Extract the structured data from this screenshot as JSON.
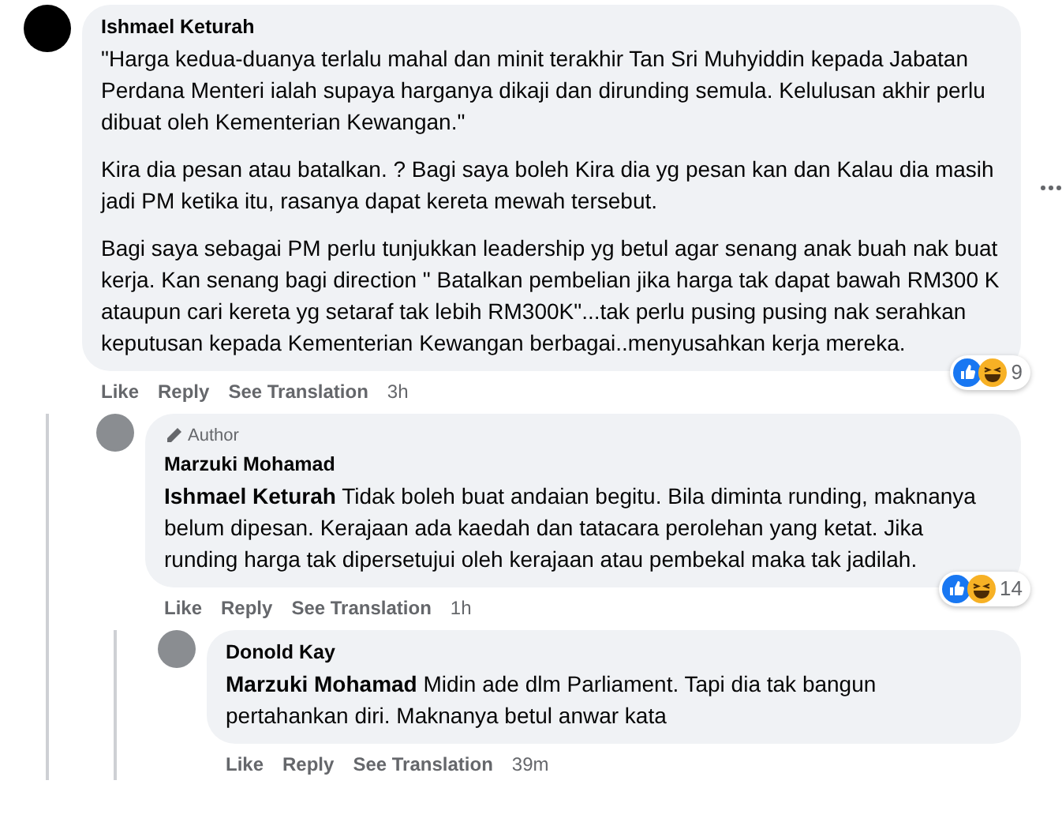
{
  "comments": [
    {
      "author": "Ishmael Keturah",
      "paragraphs": [
        "\"Harga kedua-duanya terlalu mahal dan minit terakhir Tan Sri Muhyiddin kepada Jabatan Perdana Menteri ialah supaya harganya dikaji dan dirunding semula. Kelulusan akhir perlu dibuat oleh Kementerian Kewangan.\"",
        "Kira dia pesan atau batalkan. ? Bagi saya boleh Kira dia yg pesan kan dan Kalau dia masih jadi PM ketika itu, rasanya dapat kereta mewah tersebut.",
        "Bagi saya sebagai PM perlu tunjukkan leadership yg betul agar senang anak buah nak buat kerja. Kan senang bagi direction \" Batalkan pembelian jika harga tak dapat bawah RM300 K ataupun cari kereta yg setaraf tak lebih RM300K\"...tak perlu pusing pusing nak serahkan keputusan kepada Kementerian Kewangan berbagai..menyusahkan kerja mereka."
      ],
      "actions": [
        "Like",
        "Reply",
        "See Translation"
      ],
      "time": "3h",
      "reactions": {
        "count": "9"
      },
      "more_menu": true,
      "children": [
        {
          "author": "Marzuki Mohamad",
          "badge": "Author",
          "paragraphs": [
            "**Ishmael Keturah** Tidak boleh buat andaian begitu. Bila diminta runding, maknanya belum dipesan. Kerajaan ada kaedah dan tatacara perolehan yang ketat. Jika runding harga tak dipersetujui oleh kerajaan atau pembekal maka tak jadilah."
          ],
          "actions": [
            "Like",
            "Reply",
            "See Translation"
          ],
          "time": "1h",
          "reactions": {
            "count": "14"
          },
          "children": [
            {
              "author": "Donold Kay",
              "paragraphs": [
                "**Marzuki Mohamad** Midin ade dlm Parliament. Tapi dia tak bangun pertahankan diri. Maknanya betul anwar kata"
              ],
              "actions": [
                "Like",
                "Reply",
                "See Translation"
              ],
              "time": "39m"
            }
          ]
        }
      ]
    }
  ]
}
